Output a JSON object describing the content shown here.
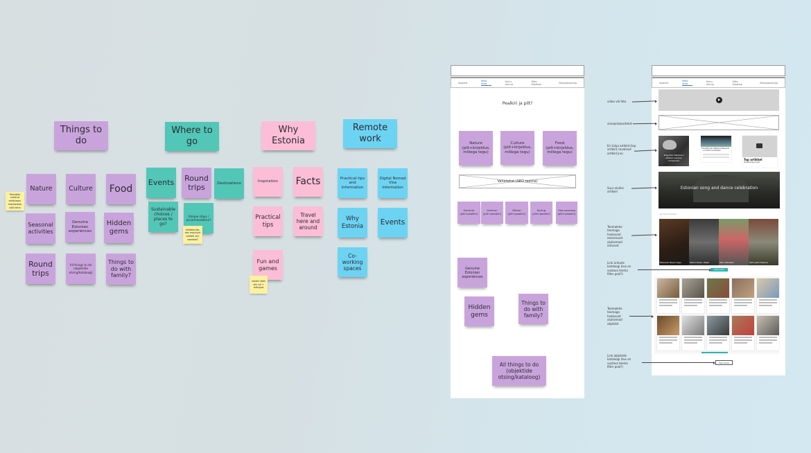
{
  "board": {
    "clusters": [
      {
        "id": "things-to-do",
        "title": "Things to do",
        "notes": [
          "Nature",
          "Culture",
          "Food",
          "Seasonal activities",
          "Genuine Estonian experiences",
          "Hidden gems",
          "Round trips",
          "All things to do (objektide otsing/kataloog)",
          "Things to do with family?"
        ],
        "comments": [
          "Peredele suletud sektsiooni teemadest võib teha"
        ]
      },
      {
        "id": "where-to-go",
        "title": "Where to go",
        "notes": [
          "Events",
          "Round trips",
          "Destinations",
          "Sustainable choices / places to go?",
          "Unique stays / accommodation?"
        ],
        "comments": [
          "Valideerida, kas majutust tulebki siin vaadata?"
        ]
      },
      {
        "id": "why-estonia",
        "title": "Why Estonia",
        "notes": [
          "Inspiration",
          "Facts",
          "Practical tips",
          "Travel here and around",
          "Fun and games"
        ],
        "comments": [
          "veider tõsti siin all + mängud"
        ]
      },
      {
        "id": "remote-work",
        "title": "Remote work",
        "notes": [
          "Practical tips and information",
          "Digital Nomad Visa information",
          "Why Estonia",
          "Events",
          "Co-working spaces"
        ]
      }
    ]
  },
  "wireframe_left": {
    "nav": [
      "Avaleht",
      "Mida teha",
      "Kuhu minna",
      "Miks Eestisse",
      "Reisiplaneerija"
    ],
    "nav_active": 1,
    "heading": "Pealkiri ja pilt?",
    "category_notes": [
      "Nature (pilt+kirjeldus, millega tegu)",
      "Culture (pilt+kirjeldus, millega tegu)",
      "Food (pilt+kirjeldus, millega tegu)"
    ],
    "seo_text": "Vahetekst (SEO teema)",
    "season_notes": [
      "Summer (pilt+pealkiri)",
      "Autumn (pilt+pealkiri)",
      "Winter (pilt+pealkiri)",
      "Spring (pilt+pealkiri)",
      "Viso sesoneg (pilt+pealkiri)"
    ],
    "lower_notes": [
      "Genuine Estonian experiences",
      "Hidden gems",
      "Things to do with family?",
      "All things to do (objektide otsing/kataloog)"
    ]
  },
  "wireframe_right": {
    "nav": [
      "Avaleht",
      "Mida teha",
      "Kuhu minna",
      "Miks Eestisse",
      "Reisiplaneerija"
    ],
    "nav_active": 1,
    "annotations": [
      "video või foto",
      "sissejuhatus/tekst",
      "Eri tüüpi artiklid (top artiklid, tavalised artiklid jne)",
      "Suur oluline artikkel",
      "Teemalehe teemaga haakuvad eesseisvad olulisemad üritused",
      "Link ürituste kataloogi (kus on vastava teema filter peal?)",
      "Teemalehe teemaga haakuvad olulisemad objektid",
      "Link objektide kataloogi (kus on vastava teema filter peal?)"
    ],
    "article_cards": [
      {
        "title": "Kreg Parn Estonia's wildest culinary companion"
      },
      {
        "title": "The Estonian National Museum – a modern landmark"
      },
      {
        "title": "Top artikkel",
        "subtitle": "Tekst/kiisiga teest"
      }
    ],
    "hero_article_title": "Estonian song and dance celebration",
    "events_label": "Suured üritused",
    "events": [
      "Estonian Music Days",
      "Tallinn Music Week",
      "Tartu Maraton",
      "Tartu Jazz Festival"
    ],
    "events_button": "Vaata üritusi",
    "see_more_button": "See more",
    "objects_rows": 2,
    "objects_per_row": 5
  }
}
